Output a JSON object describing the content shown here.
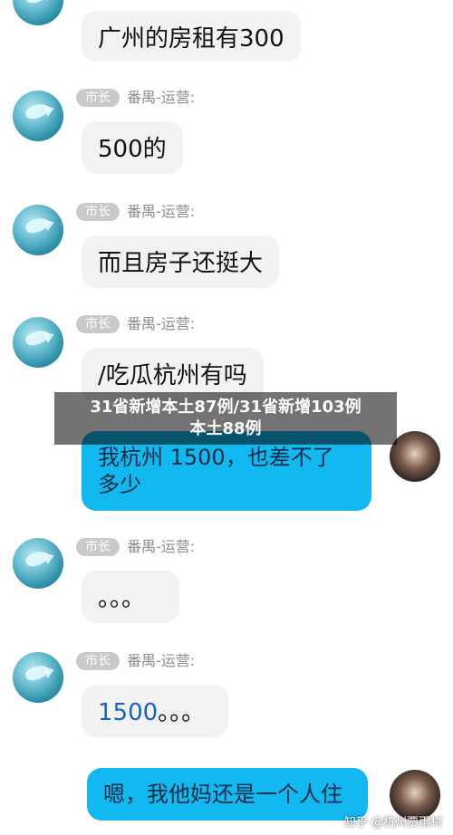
{
  "messages": {
    "m1_text": "广州的房租有300",
    "role_tag": "市长",
    "sender_name": "番禺-运营:",
    "m2_text": "500的",
    "m3_text": "而且房子还挺大",
    "m4_text": "/吃瓜杭州有吗",
    "m5_text": "我杭州 1500，也差不了多少",
    "m6_text": "。。。",
    "m7_num": "1500",
    "m7_dots": "。。。",
    "m8_text": "嗯，我他妈还是一个人住"
  },
  "banner": {
    "line1": "31省新增本土87例/31省新增103例",
    "line2": "本土88例"
  },
  "watermark": "知乎 @杭州贾雨村",
  "colors": {
    "accent_blue": "#12b8f0",
    "bubble_gray": "#f2f2f2",
    "tag_gray": "#c9c9c9"
  }
}
